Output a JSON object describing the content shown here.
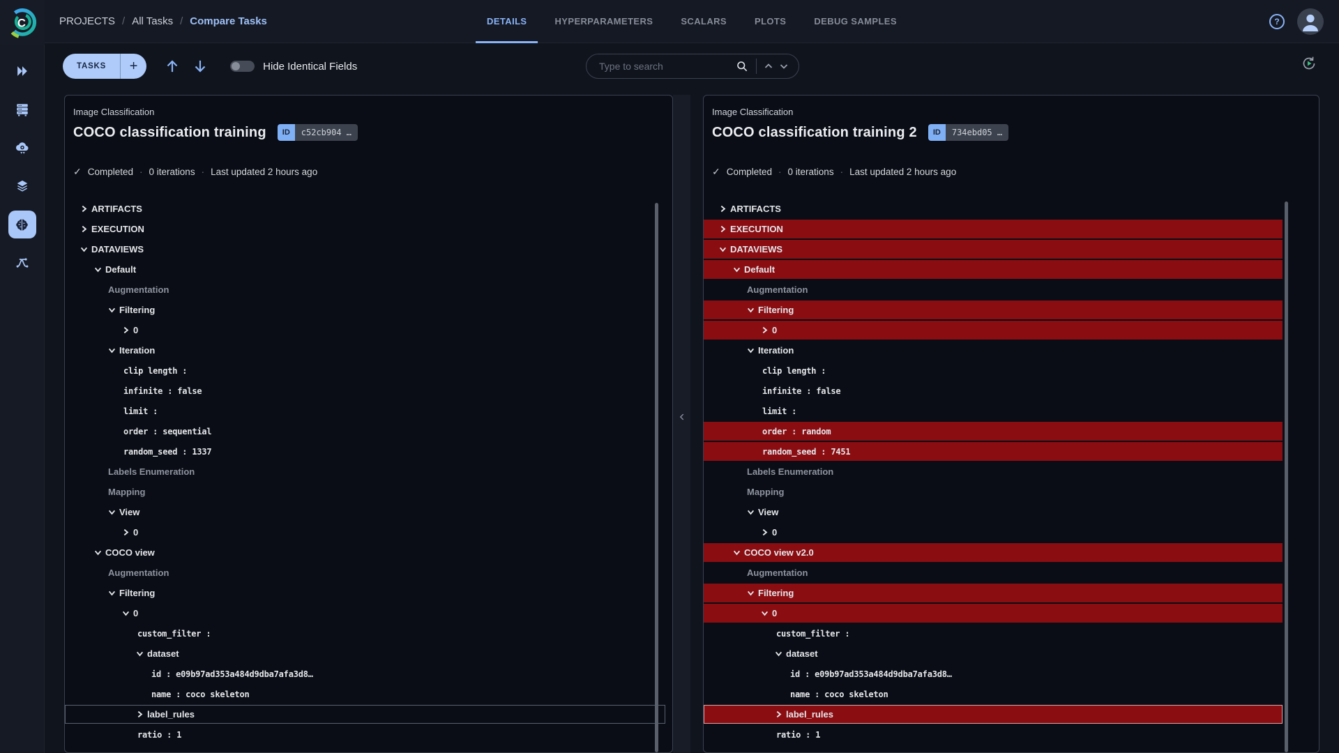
{
  "ui": {
    "dot": "·",
    "check": "✓",
    "help": "?",
    "logo_letter": "C"
  },
  "colors": {
    "accent": "#8ab4f8",
    "button_blue": "#aecbfa",
    "diff_highlight": "#8a0d12",
    "panel_bg": "#0a0d15"
  },
  "breadcrumb": {
    "items": [
      "PROJECTS",
      "All Tasks",
      "Compare Tasks"
    ],
    "separator": "/"
  },
  "tabs": {
    "items": [
      {
        "label": "DETAILS",
        "active": true
      },
      {
        "label": "HYPERPARAMETERS",
        "active": false
      },
      {
        "label": "SCALARS",
        "active": false
      },
      {
        "label": "PLOTS",
        "active": false
      },
      {
        "label": "DEBUG SAMPLES",
        "active": false
      }
    ]
  },
  "sidebar": {
    "icons": [
      "projects",
      "workers-queues",
      "applications",
      "datasets",
      "hyper-datasets",
      "pipelines"
    ],
    "active": "hyper-datasets"
  },
  "toolbar": {
    "tasks_label": "TASKS",
    "add_label": "+",
    "hide_toggle_label": "Hide Identical Fields",
    "hide_toggle_on": false,
    "search_placeholder": "Type to search",
    "icons": [
      "arrow-up",
      "arrow-down",
      "search",
      "chevron-up",
      "chevron-down",
      "auto-refresh"
    ]
  },
  "panels": [
    {
      "project": "Image Classification",
      "title": "COCO classification training",
      "id_badge": "ID",
      "id_value": "c52cb904 …",
      "status": "Completed",
      "iterations": "0 iterations",
      "updated": "Last updated 2 hours ago",
      "rows": [
        {
          "label": "ARTIFACTS",
          "level": 0,
          "chevron": "right"
        },
        {
          "label": "EXECUTION",
          "level": 0,
          "chevron": "right"
        },
        {
          "label": "DATAVIEWS",
          "level": 0,
          "chevron": "down"
        },
        {
          "label": "Default",
          "level": 1,
          "chevron": "down"
        },
        {
          "label": "Augmentation",
          "level": 2,
          "muted": true
        },
        {
          "label": "Filtering",
          "level": 2,
          "chevron": "down"
        },
        {
          "label": "0",
          "level": 3,
          "chevron": "right"
        },
        {
          "label": "Iteration",
          "level": 2,
          "chevron": "down"
        },
        {
          "label": "clip length :",
          "level": 3,
          "mono": true
        },
        {
          "label": "infinite : false",
          "level": 3,
          "mono": true
        },
        {
          "label": "limit :",
          "level": 3,
          "mono": true
        },
        {
          "label": "order : sequential",
          "level": 3,
          "mono": true
        },
        {
          "label": "random_seed : 1337",
          "level": 3,
          "mono": true
        },
        {
          "label": "Labels Enumeration",
          "level": 2,
          "muted": true
        },
        {
          "label": "Mapping",
          "level": 2,
          "muted": true
        },
        {
          "label": "View",
          "level": 2,
          "chevron": "down"
        },
        {
          "label": "0",
          "level": 3,
          "chevron": "right"
        },
        {
          "label": "COCO view",
          "level": 1,
          "chevron": "down"
        },
        {
          "label": "Augmentation",
          "level": 2,
          "muted": true
        },
        {
          "label": "Filtering",
          "level": 2,
          "chevron": "down"
        },
        {
          "label": "0",
          "level": 3,
          "chevron": "down"
        },
        {
          "label": "custom_filter :",
          "level": 4,
          "mono": true
        },
        {
          "label": "dataset",
          "level": 4,
          "chevron": "down"
        },
        {
          "label": "id : e09b97ad353a484d9dba7afa3d8…",
          "level": 5,
          "mono": true
        },
        {
          "label": "name : coco skeleton",
          "level": 5,
          "mono": true
        },
        {
          "label": "label_rules",
          "level": 4,
          "chevron": "right",
          "outlined": true
        },
        {
          "label": "ratio : 1",
          "level": 4,
          "mono": true
        }
      ]
    },
    {
      "project": "Image Classification",
      "title": "COCO classification training 2",
      "id_badge": "ID",
      "id_value": "734ebd05 …",
      "status": "Completed",
      "iterations": "0 iterations",
      "updated": "Last updated 2 hours ago",
      "rows": [
        {
          "label": "ARTIFACTS",
          "level": 0,
          "chevron": "right"
        },
        {
          "label": "EXECUTION",
          "level": 0,
          "chevron": "right",
          "diff": true
        },
        {
          "label": "DATAVIEWS",
          "level": 0,
          "chevron": "down",
          "diff": true
        },
        {
          "label": "Default",
          "level": 1,
          "chevron": "down",
          "diff": true
        },
        {
          "label": "Augmentation",
          "level": 2,
          "muted": true
        },
        {
          "label": "Filtering",
          "level": 2,
          "chevron": "down",
          "diff": true
        },
        {
          "label": "0",
          "level": 3,
          "chevron": "right",
          "diff": true
        },
        {
          "label": "Iteration",
          "level": 2,
          "chevron": "down"
        },
        {
          "label": "clip length :",
          "level": 3,
          "mono": true
        },
        {
          "label": "infinite : false",
          "level": 3,
          "mono": true
        },
        {
          "label": "limit :",
          "level": 3,
          "mono": true
        },
        {
          "label": "order : random",
          "level": 3,
          "mono": true,
          "diff": true
        },
        {
          "label": "random_seed : 7451",
          "level": 3,
          "mono": true,
          "diff": true
        },
        {
          "label": "Labels Enumeration",
          "level": 2,
          "muted": true
        },
        {
          "label": "Mapping",
          "level": 2,
          "muted": true
        },
        {
          "label": "View",
          "level": 2,
          "chevron": "down"
        },
        {
          "label": "0",
          "level": 3,
          "chevron": "right"
        },
        {
          "label": "COCO view v2.0",
          "level": 1,
          "chevron": "down",
          "diff": true
        },
        {
          "label": "Augmentation",
          "level": 2,
          "muted": true
        },
        {
          "label": "Filtering",
          "level": 2,
          "chevron": "down",
          "diff": true
        },
        {
          "label": "0",
          "level": 3,
          "chevron": "down",
          "diff": true
        },
        {
          "label": "custom_filter :",
          "level": 4,
          "mono": true
        },
        {
          "label": "dataset",
          "level": 4,
          "chevron": "down"
        },
        {
          "label": "id : e09b97ad353a484d9dba7afa3d8…",
          "level": 5,
          "mono": true
        },
        {
          "label": "name : coco skeleton",
          "level": 5,
          "mono": true
        },
        {
          "label": "label_rules",
          "level": 4,
          "chevron": "right",
          "outlined": true,
          "diff": true
        },
        {
          "label": "ratio : 1",
          "level": 4,
          "mono": true
        }
      ]
    }
  ]
}
